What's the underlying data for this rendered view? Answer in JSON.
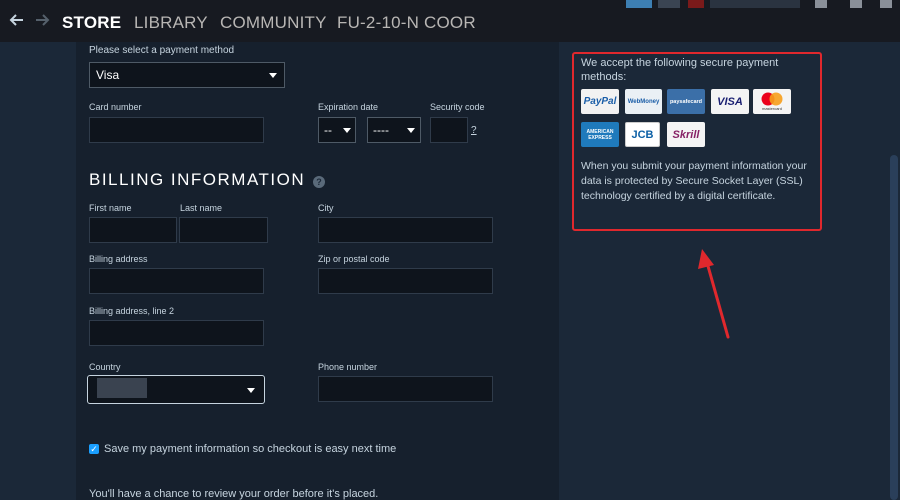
{
  "nav": {
    "back_icon": "arrow-left-icon",
    "forward_icon": "arrow-right-icon",
    "links": [
      "STORE",
      "LIBRARY",
      "COMMUNITY",
      "FU-2-10-N COOR"
    ]
  },
  "payment": {
    "method_label": "Please select a payment method",
    "method_value": "Visa",
    "card_number_label": "Card number",
    "expiration_label": "Expiration date",
    "exp_month": "--",
    "exp_year": "----",
    "security_code_label": "Security code",
    "security_help": "?"
  },
  "billing": {
    "heading": "BILLING INFORMATION",
    "help": "?",
    "first_name_label": "First name",
    "last_name_label": "Last name",
    "city_label": "City",
    "address_label": "Billing address",
    "zip_label": "Zip or postal code",
    "address2_label": "Billing address, line 2",
    "country_label": "Country",
    "phone_label": "Phone number",
    "save_checkbox_label": "Save my payment information so checkout is easy next time",
    "save_checked": true,
    "review_note": "You'll have a chance to review your order before it's placed."
  },
  "sidebar": {
    "accept_text": "We accept the following secure payment methods:",
    "ssl_text": "When you submit your payment information your data is protected by Secure Socket Layer (SSL) technology certified by a digital certificate.",
    "logos": [
      "PayPal",
      "WebMoney",
      "paysafecard",
      "VISA",
      "mastercard",
      "AMERICAN EXPRESS",
      "JCB",
      "Skrill"
    ]
  },
  "colors": {
    "accent_blue": "#1a9fff",
    "annotation_red": "#e0282d",
    "background": "#1b2838"
  }
}
